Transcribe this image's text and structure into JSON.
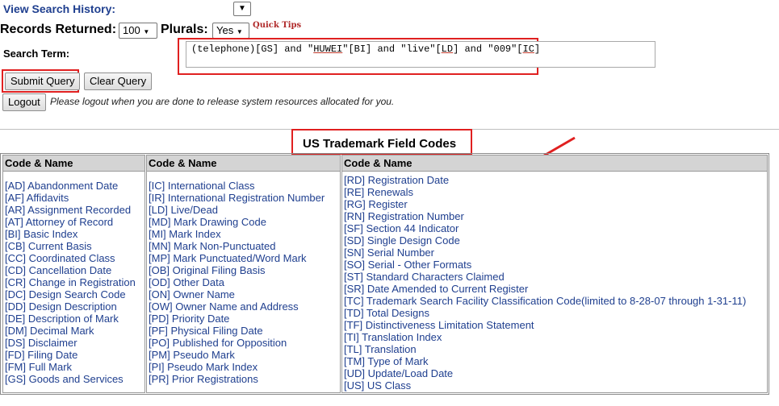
{
  "header": {
    "view_history": "View Search History:",
    "records_label": "Records Returned:",
    "records_value": "100",
    "plurals_label": "Plurals:",
    "plurals_value": "Yes",
    "quick_tips": "Quick Tips",
    "search_label": "Search Term:"
  },
  "search": {
    "segments": [
      {
        "text": "(telephone)[GS] and \"",
        "u": false
      },
      {
        "text": "HUWEI",
        "u": true
      },
      {
        "text": "\"[BI] and \"live\"[",
        "u": false
      },
      {
        "text": "LD",
        "u": true
      },
      {
        "text": "] and \"009\"[",
        "u": false
      },
      {
        "text": "IC",
        "u": true
      },
      {
        "text": "]",
        "u": false
      }
    ]
  },
  "buttons": {
    "submit": "Submit Query",
    "clear": "Clear Query",
    "logout": "Logout"
  },
  "logout_note": "Please logout when you are done to release system resources allocated for you.",
  "codes": {
    "title": "US Trademark Field Codes",
    "columns": [
      {
        "header": "Code & Name",
        "items": [
          "[AD] Abandonment Date",
          "[AF] Affidavits",
          "[AR] Assignment Recorded",
          "[AT] Attorney of Record",
          "[BI] Basic Index",
          "[CB] Current Basis",
          "[CC] Coordinated Class",
          "[CD] Cancellation Date",
          "[CR] Change in Registration",
          "[DC] Design Search Code",
          "[DD] Design Description",
          "[DE] Description of Mark",
          "[DM] Decimal Mark",
          "[DS] Disclaimer",
          "[FD] Filing Date",
          "[FM] Full Mark",
          "[GS] Goods and Services"
        ]
      },
      {
        "header": "Code & Name",
        "items": [
          "[IC] International Class",
          "[IR] International Registration Number",
          "[LD] Live/Dead",
          "[MD] Mark Drawing Code",
          "[MI] Mark Index",
          "[MN] Mark Non-Punctuated",
          "[MP] Mark Punctuated/Word Mark",
          "[OB] Original Filing Basis",
          "[OD] Other Data",
          "[ON] Owner Name",
          "[OW] Owner Name and Address",
          "[PD] Priority Date",
          "[PF] Physical Filing Date",
          "[PO] Published for Opposition",
          "[PM] Pseudo Mark",
          "[PI] Pseudo Mark Index",
          "[PR] Prior Registrations"
        ]
      },
      {
        "header": "Code & Name",
        "items": [
          "[RD] Registration Date",
          "[RE] Renewals",
          "[RG] Register",
          "[RN] Registration Number",
          "[SF] Section 44 Indicator",
          "[SD] Single Design Code",
          "[SN] Serial Number",
          "[SO] Serial - Other Formats",
          "[ST] Standard Characters Claimed",
          "[SR] Date Amended to Current Register",
          "[TC] Trademark Search Facility Classification Code(limited to 8-28-07 through 1-31-11)",
          "[TD] Total Designs",
          "[TF] Distinctiveness Limitation Statement",
          "[TI] Translation Index",
          "[TL] Translation",
          "[TM] Type of Mark",
          "[UD] Update/Load Date",
          "[US] US Class"
        ]
      }
    ]
  },
  "colors": {
    "link": "#1f3f8f",
    "annotation_red": "#e02020",
    "header_bg": "#d4d4d4"
  }
}
